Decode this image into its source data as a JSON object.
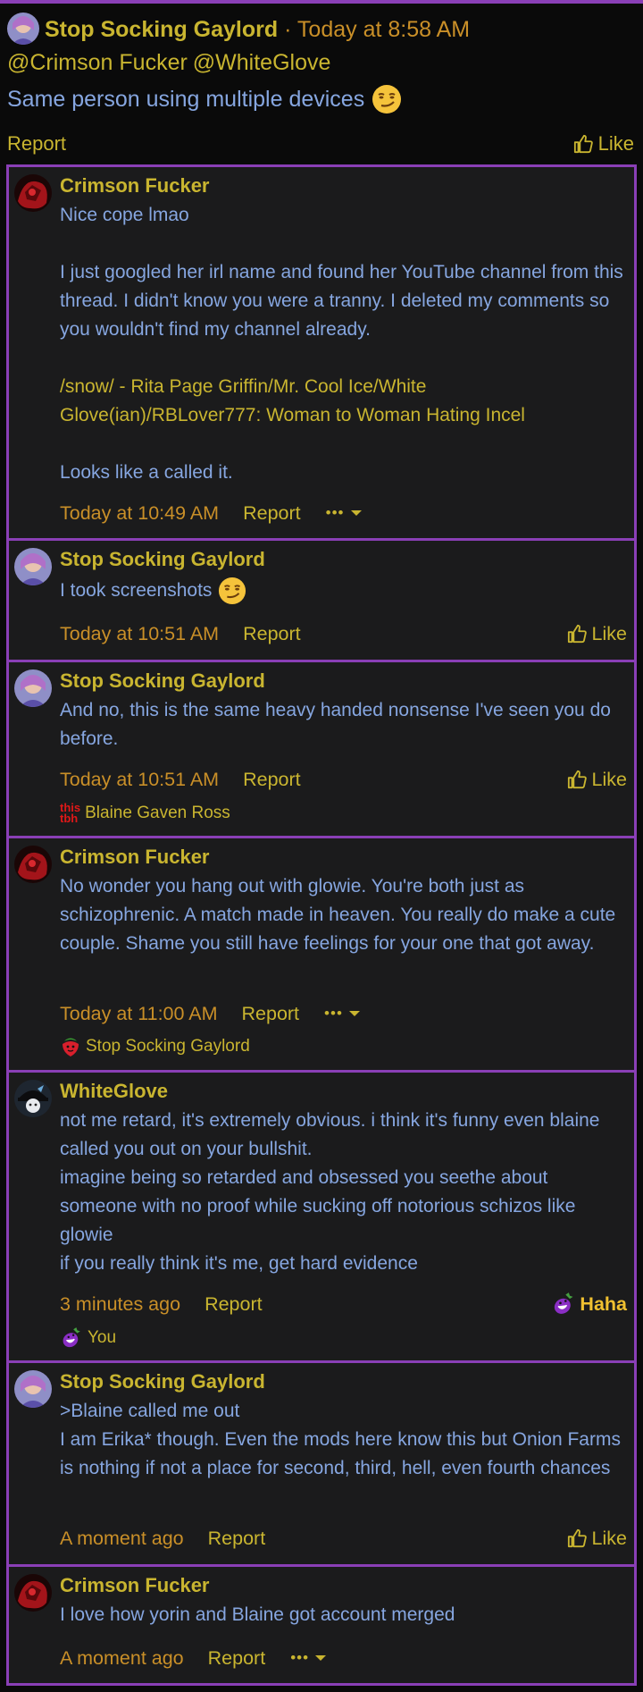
{
  "header": {
    "author": "Stop Socking Gaylord",
    "separator": " · ",
    "time": "Today at 8:58 AM",
    "mentions": [
      "@Crimson Fucker",
      "@WhiteGlove"
    ],
    "text": "Same person using multiple devices",
    "report_label": "Report",
    "like_label": "Like"
  },
  "replies": [
    {
      "author": "Crimson Fucker",
      "lines": [
        "Nice cope lmao",
        "",
        "I just googled her irl name and found her YouTube channel from this thread. I didn't know you were a tranny. I deleted my comments so you wouldn't find my channel already.",
        "",
        "/snow/ - Rita Page Griffin/Mr. Cool Ice/White Glove(ian)/RBLover777: Woman to Woman Hating Incel",
        "",
        "Looks like a called it."
      ],
      "time": "Today at 10:49 AM",
      "report_label": "Report",
      "more_label": "•••"
    },
    {
      "author": "Stop Socking Gaylord",
      "text": "I took screenshots",
      "time": "Today at 10:51 AM",
      "report_label": "Report",
      "like_label": "Like"
    },
    {
      "author": "Stop Socking Gaylord",
      "text": "And no, this is the same heavy handed nonsense I've seen you do before.",
      "time": "Today at 10:51 AM",
      "report_label": "Report",
      "like_label": "Like",
      "reaction_icon_top": "this",
      "reaction_icon_bottom": "tbh",
      "reaction_by": "Blaine Gaven Ross"
    },
    {
      "author": "Crimson Fucker",
      "text": "No wonder you hang out with glowie. You're both just as schizophrenic. A match made in heaven. You really do make a cute couple. Shame you still have feelings for your one that got away.",
      "time": "Today at 11:00 AM",
      "report_label": "Report",
      "more_label": "•••",
      "reaction_by": "Stop Socking Gaylord"
    },
    {
      "author": "WhiteGlove",
      "lines": [
        "not me retard, it's extremely obvious. i think it's funny even blaine called you out on your bullshit.",
        "imagine being so retarded and obsessed you seethe about someone with no proof while sucking off notorious schizos like glowie",
        "if you really think it's me, get hard evidence"
      ],
      "time": "3 minutes ago",
      "report_label": "Report",
      "haha_label": "Haha",
      "reaction_by": "You"
    },
    {
      "author": "Stop Socking Gaylord",
      "lines": [
        ">Blaine called me out",
        "I am Erika* though. Even the mods here know this but Onion Farms is nothing if not a place for second, third, hell, even fourth chances"
      ],
      "time": "A moment ago",
      "report_label": "Report",
      "like_label": "Like"
    },
    {
      "author": "Crimson Fucker",
      "text": "I love how yorin and Blaine got account merged",
      "time": "A moment ago",
      "report_label": "Report",
      "more_label": "•••"
    }
  ],
  "icons": {
    "avatar_ssg": "purple-haired-avatar",
    "avatar_cf": "red-dark-avatar",
    "avatar_wg": "witch-hat-avatar",
    "smirk": "smirking-face-emoji",
    "like": "thumbs-up-icon",
    "more": "ellipsis-chevron-icon",
    "strawberry": "strawberry-face-icon",
    "eggplant": "grinning-eggplant-icon"
  },
  "colors": {
    "border": "#8a3fb6",
    "author": "#c9b530",
    "text": "#86a6e0",
    "time": "#c98f28",
    "panel": "#1b1b1c",
    "background": "#0a0a0a"
  }
}
